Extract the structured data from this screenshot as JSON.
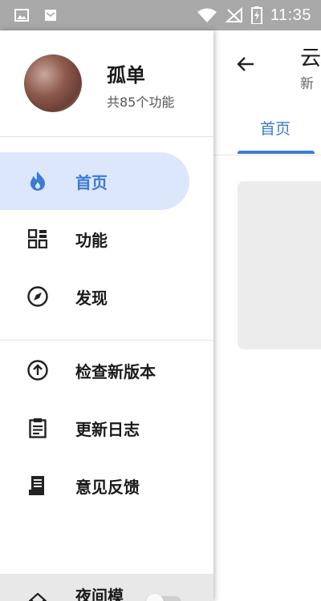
{
  "status_bar": {
    "time": "11:35",
    "left_icons": [
      "image-icon",
      "mail-icon"
    ],
    "right_icons": [
      "wifi-icon",
      "no-signal-icon",
      "battery-charging-icon"
    ]
  },
  "background_app": {
    "title": "云",
    "subtitle": "新",
    "tab": "首页",
    "accent": "#3a7bd5"
  },
  "drawer": {
    "profile": {
      "name": "孤单",
      "subtitle": "共85个功能"
    },
    "nav_items": [
      {
        "label": "首页",
        "icon": "flame-icon",
        "active": true
      },
      {
        "label": "功能",
        "icon": "grid-icon",
        "active": false
      },
      {
        "label": "发现",
        "icon": "compass-icon",
        "active": false
      }
    ],
    "secondary_items": [
      {
        "label": "检查新版本",
        "icon": "arrow-up-circle-icon"
      },
      {
        "label": "更新日志",
        "icon": "clipboard-icon"
      },
      {
        "label": "意见反馈",
        "icon": "feedback-icon"
      }
    ],
    "night_mode": {
      "label": "夜间模",
      "enabled": false
    },
    "active_color": "#3a7bd5",
    "active_bg": "#dce7fb"
  }
}
